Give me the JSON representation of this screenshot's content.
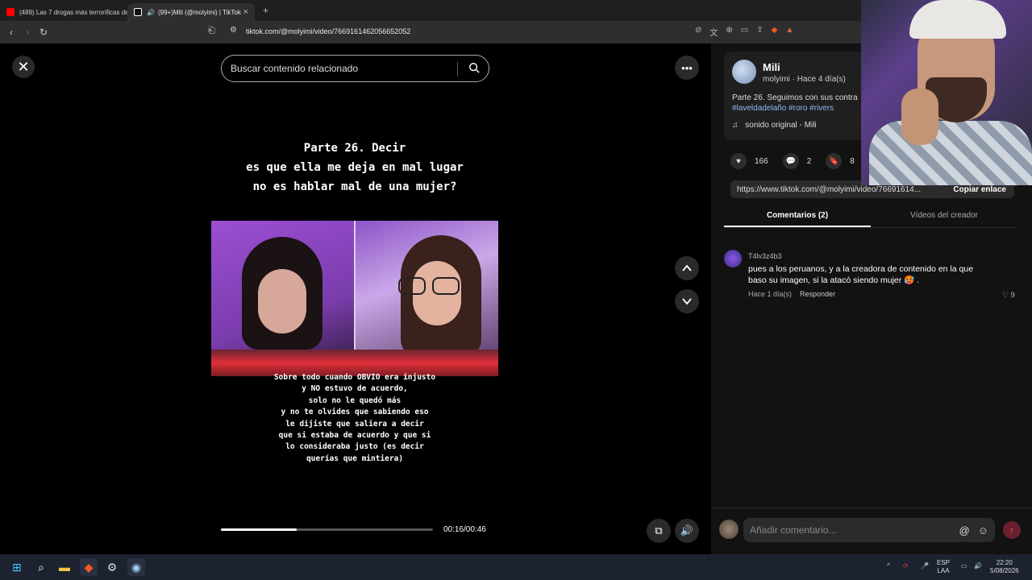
{
  "browser": {
    "tabs": [
      {
        "label": "(489) Las 7 drogas más terroríficas de",
        "active": false,
        "favicon_color": "#ff0000"
      },
      {
        "label": "(99+)Mili (@molyimi) | TikTok",
        "active": true,
        "favicon_color": "#ffffff"
      }
    ],
    "url": "tiktok.com/@molyimi/video/7669161462056652052",
    "new_tab_label": "+"
  },
  "video": {
    "search_placeholder": "Buscar contenido relacionado",
    "title_lines": [
      "Parte 26. Decir",
      "es que ella me deja en mal lugar",
      "no es hablar mal de una mujer?"
    ],
    "subtitle_lines": [
      "Sobre todo cuando OBVIO era injusto",
      "y NO estuvo de acuerdo,",
      "solo no le quedó más",
      "y no te olvides que sabiendo eso",
      "le dijiste que saliera a decir",
      "que si estaba de acuerdo y que si",
      "lo consideraba justo (es decir",
      "querías que mintiera)"
    ],
    "progress_fraction": 0.357,
    "time": "00:16/00:46"
  },
  "panel": {
    "author_name": "Mili",
    "author_meta": "molyimi · Hace 4 día(s)",
    "description": "Parte 26. Seguimos con sus contra",
    "hashtags": "#laveldadelaño #roro #rivers",
    "sound": "sonido original - Mili",
    "likes": "166",
    "comments": "2",
    "saves": "8",
    "link": "https://www.tiktok.com/@molyimi/video/76691614...",
    "copy_link": "Copiar enlace",
    "tab_comments": "Comentarios (2)",
    "tab_creator": "Vídeos del creador",
    "comment": {
      "user": "T4lv3z4b3",
      "text": "pues a los peruanos, y a la creadora de contenido en la que baso su imagen, si la atacó siendo mujer 🥵 .",
      "time": "Hace 1 día(s)",
      "reply": "Responder",
      "likes": "9"
    },
    "composer_placeholder": "Añadir comentario..."
  },
  "taskbar": {
    "lang_top": "ESP",
    "lang_bottom": "LAA",
    "clock_time": "22:20",
    "clock_date": "5/08/2026"
  },
  "colors": {
    "accent_red": "#fe2c55",
    "hashtag_blue": "#8fb8f2"
  }
}
